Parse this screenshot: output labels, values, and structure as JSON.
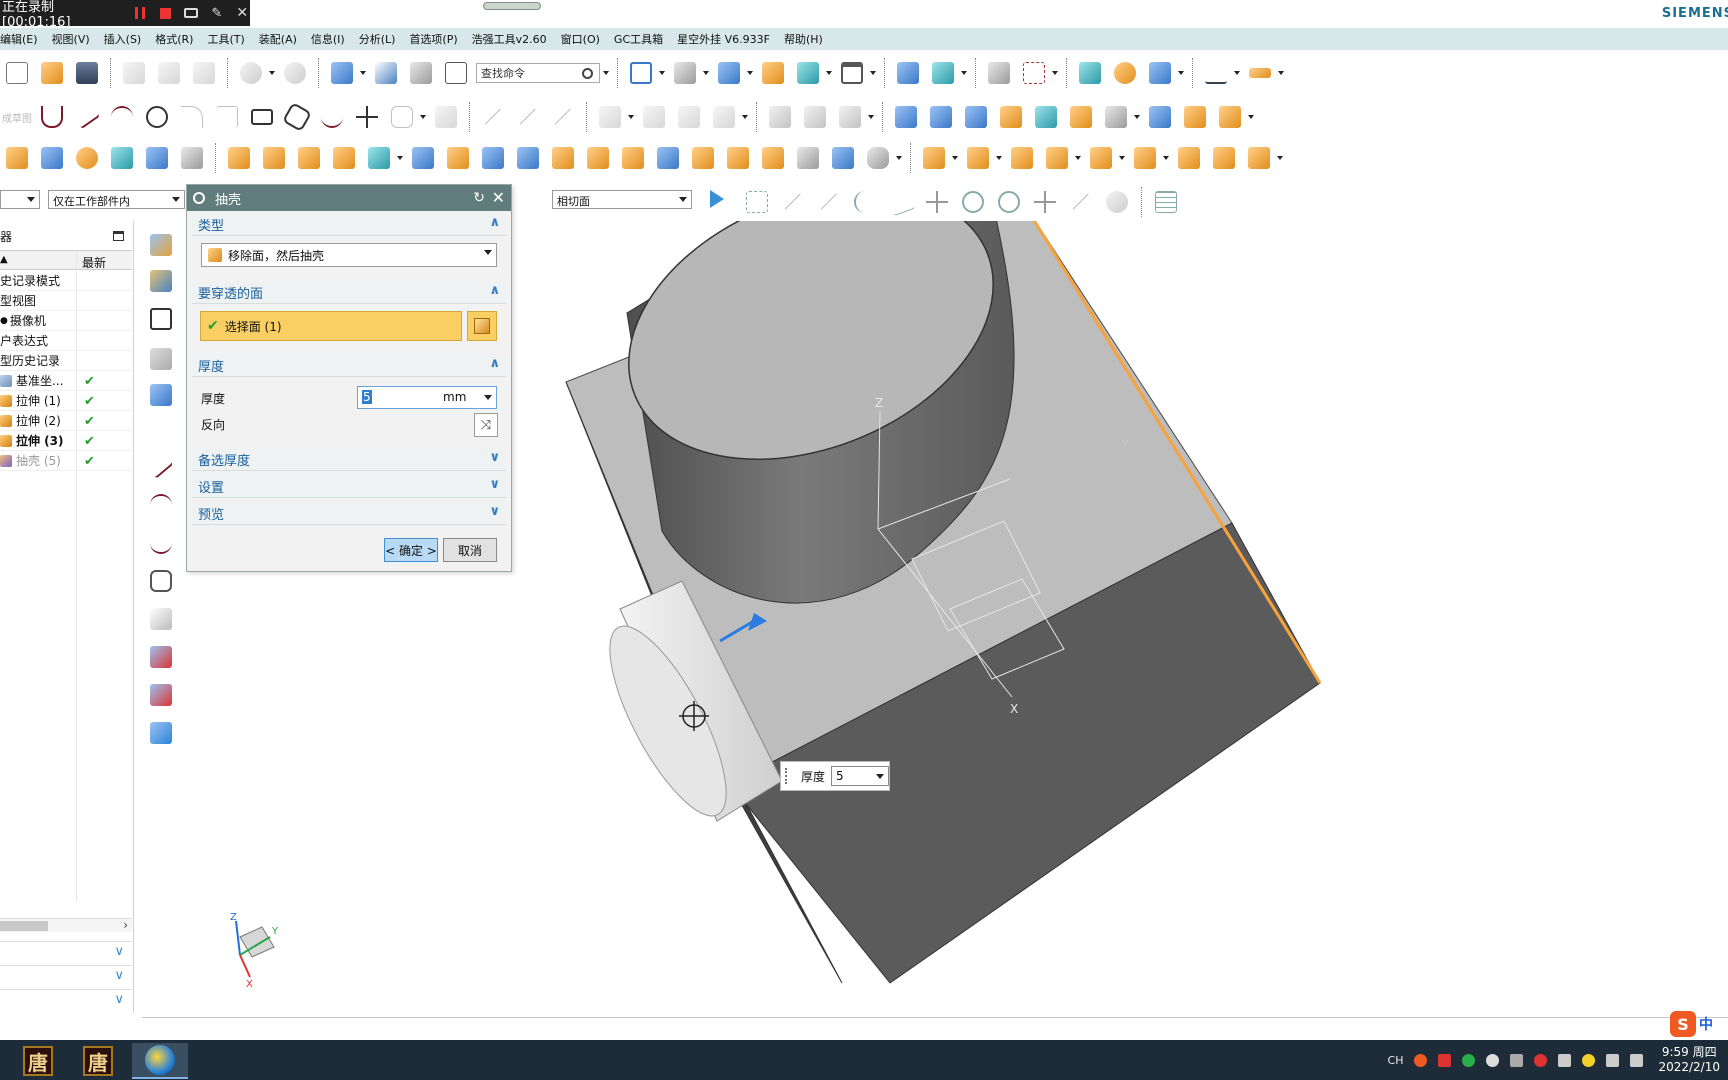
{
  "recorder": {
    "status": "正在录制 [00:01:16]",
    "icons": [
      "pause-icon",
      "stop-icon",
      "camera-icon",
      "pen-icon",
      "close-icon"
    ]
  },
  "brand": "SIEMENS",
  "menubar": [
    "编辑(E)",
    "视图(V)",
    "插入(S)",
    "格式(R)",
    "工具(T)",
    "装配(A)",
    "信息(I)",
    "分析(L)",
    "首选项(P)",
    "浩强工具v2.60",
    "窗口(O)",
    "GC工具箱",
    "星空外挂 V6.933F",
    "帮助(H)"
  ],
  "toolbar": {
    "search_placeholder": "查找命令",
    "sketch_label": "成草图"
  },
  "filters": {
    "scope": "仅在工作部件内",
    "snap": "相切面"
  },
  "navigator": {
    "title": "器",
    "col_latest": "最新",
    "rows": [
      {
        "label": "史记录模式",
        "check": false,
        "style": "normal",
        "icon": ""
      },
      {
        "label": "型视图",
        "check": false,
        "style": "normal",
        "icon": ""
      },
      {
        "label": "摄像机",
        "check": false,
        "style": "normal",
        "icon": "camera-icon"
      },
      {
        "label": "户表达式",
        "check": false,
        "style": "normal",
        "icon": ""
      },
      {
        "label": "型历史记录",
        "check": false,
        "style": "normal",
        "icon": ""
      },
      {
        "label": "基准坐...",
        "check": true,
        "style": "normal",
        "icon": "datum-csys-icon"
      },
      {
        "label": "拉伸 (1)",
        "check": true,
        "style": "normal",
        "icon": "extrude-icon"
      },
      {
        "label": "拉伸 (2)",
        "check": true,
        "style": "normal",
        "icon": "extrude-icon"
      },
      {
        "label": "拉伸 (3)",
        "check": true,
        "style": "bold",
        "icon": "extrude-icon"
      },
      {
        "label": "抽壳 (5)",
        "check": true,
        "style": "dim",
        "icon": "shell-icon"
      }
    ]
  },
  "dialog": {
    "title": "抽壳",
    "sections": {
      "type": "类型",
      "faces": "要穿透的面",
      "thickness": "厚度",
      "alt_thickness": "备选厚度",
      "settings": "设置",
      "preview": "预览"
    },
    "type_value": "移除面，然后抽壳",
    "select_face": "选择面 (1)",
    "thickness_label": "厚度",
    "thickness_value": "5",
    "thickness_unit": "mm",
    "reverse_label": "反向",
    "ok_label": "< 确定 >",
    "cancel_label": "取消"
  },
  "scene": {
    "axis_labels": {
      "z": "Z",
      "x": "X",
      "y": "Y"
    },
    "triad_labels": {
      "z": "Z",
      "y": "Y",
      "x": "X"
    },
    "float_label": "厚度",
    "float_value": "5"
  },
  "taskbar": {
    "lang": "CH",
    "time": "9:59 周四",
    "date": "2022/2/10",
    "ime_label": "中",
    "ime_logo": "S",
    "app_glyph": "唐"
  },
  "colors": {
    "menubar_bg": "#d8e7e7",
    "dialog_title_bg": "#607c7c",
    "select_highlight": "#f9cf63",
    "edge_highlight": "#f7a23a",
    "taskbar_bg": "#1e2b38"
  }
}
